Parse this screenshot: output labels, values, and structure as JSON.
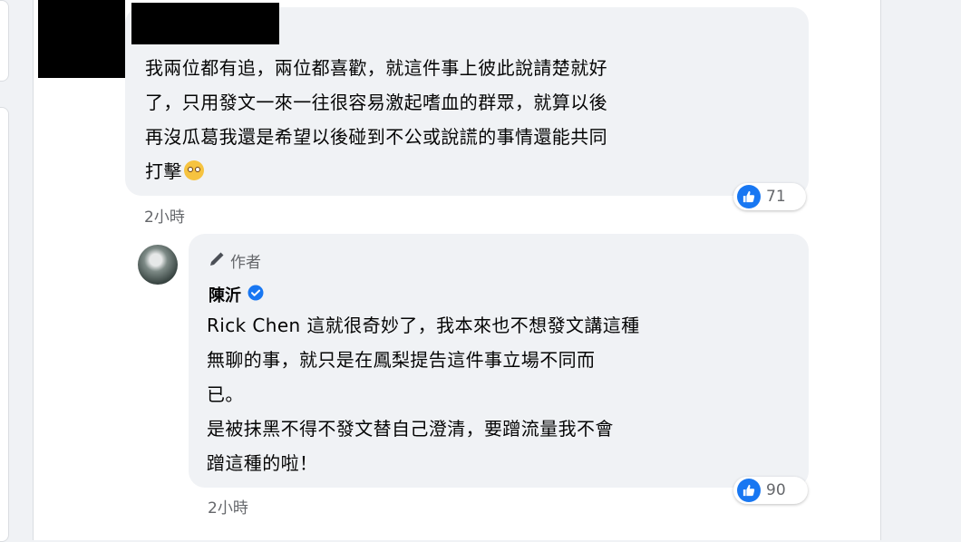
{
  "comment1": {
    "text": "我兩位都有追，兩位都喜歡，就這件事上彼此說請楚就好\n了，只用發文一來一往很容易激起嗜血的群眾，就算以後\n再沒瓜葛我還是希望以後碰到不公或說謊的事情還能共同\n打擊",
    "reaction_count": "71",
    "time": "2小時"
  },
  "reply": {
    "author_badge": "作者",
    "author_name": "陳沂",
    "text": "Rick Chen 這就很奇妙了，我本來也不想發文講這種\n無聊的事，就只是在鳳梨提告這件事立場不同而\n已。\n是被抹黑不得不發文替自己澄清，要蹭流量我不會\n蹭這種的啦！",
    "reaction_count": "90",
    "time": "2小時"
  },
  "colors": {
    "accent": "#1877f2",
    "bubble": "#f0f2f5",
    "secondary_text": "#65676b"
  },
  "icons": [
    "like-icon",
    "pencil-icon",
    "verified-badge-icon",
    "pleading-face-emoji"
  ]
}
